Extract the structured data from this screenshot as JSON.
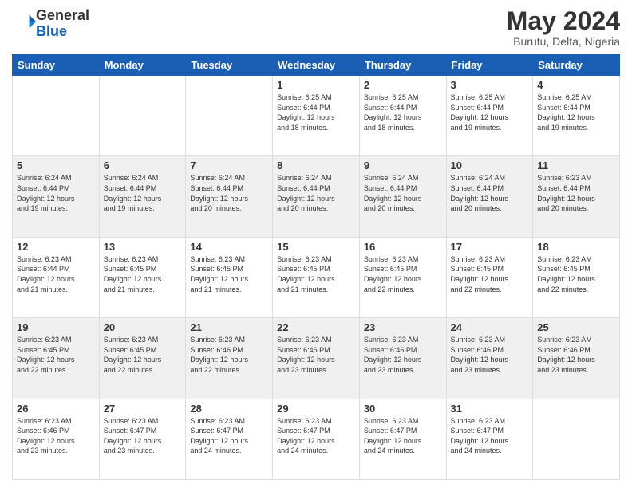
{
  "header": {
    "logo_text_general": "General",
    "logo_text_blue": "Blue",
    "month_year": "May 2024",
    "location": "Burutu, Delta, Nigeria"
  },
  "calendar": {
    "days_of_week": [
      "Sunday",
      "Monday",
      "Tuesday",
      "Wednesday",
      "Thursday",
      "Friday",
      "Saturday"
    ],
    "weeks": [
      [
        {
          "day": "",
          "info": ""
        },
        {
          "day": "",
          "info": ""
        },
        {
          "day": "",
          "info": ""
        },
        {
          "day": "1",
          "info": "Sunrise: 6:25 AM\nSunset: 6:44 PM\nDaylight: 12 hours\nand 18 minutes."
        },
        {
          "day": "2",
          "info": "Sunrise: 6:25 AM\nSunset: 6:44 PM\nDaylight: 12 hours\nand 18 minutes."
        },
        {
          "day": "3",
          "info": "Sunrise: 6:25 AM\nSunset: 6:44 PM\nDaylight: 12 hours\nand 19 minutes."
        },
        {
          "day": "4",
          "info": "Sunrise: 6:25 AM\nSunset: 6:44 PM\nDaylight: 12 hours\nand 19 minutes."
        }
      ],
      [
        {
          "day": "5",
          "info": "Sunrise: 6:24 AM\nSunset: 6:44 PM\nDaylight: 12 hours\nand 19 minutes."
        },
        {
          "day": "6",
          "info": "Sunrise: 6:24 AM\nSunset: 6:44 PM\nDaylight: 12 hours\nand 19 minutes."
        },
        {
          "day": "7",
          "info": "Sunrise: 6:24 AM\nSunset: 6:44 PM\nDaylight: 12 hours\nand 20 minutes."
        },
        {
          "day": "8",
          "info": "Sunrise: 6:24 AM\nSunset: 6:44 PM\nDaylight: 12 hours\nand 20 minutes."
        },
        {
          "day": "9",
          "info": "Sunrise: 6:24 AM\nSunset: 6:44 PM\nDaylight: 12 hours\nand 20 minutes."
        },
        {
          "day": "10",
          "info": "Sunrise: 6:24 AM\nSunset: 6:44 PM\nDaylight: 12 hours\nand 20 minutes."
        },
        {
          "day": "11",
          "info": "Sunrise: 6:23 AM\nSunset: 6:44 PM\nDaylight: 12 hours\nand 20 minutes."
        }
      ],
      [
        {
          "day": "12",
          "info": "Sunrise: 6:23 AM\nSunset: 6:44 PM\nDaylight: 12 hours\nand 21 minutes."
        },
        {
          "day": "13",
          "info": "Sunrise: 6:23 AM\nSunset: 6:45 PM\nDaylight: 12 hours\nand 21 minutes."
        },
        {
          "day": "14",
          "info": "Sunrise: 6:23 AM\nSunset: 6:45 PM\nDaylight: 12 hours\nand 21 minutes."
        },
        {
          "day": "15",
          "info": "Sunrise: 6:23 AM\nSunset: 6:45 PM\nDaylight: 12 hours\nand 21 minutes."
        },
        {
          "day": "16",
          "info": "Sunrise: 6:23 AM\nSunset: 6:45 PM\nDaylight: 12 hours\nand 22 minutes."
        },
        {
          "day": "17",
          "info": "Sunrise: 6:23 AM\nSunset: 6:45 PM\nDaylight: 12 hours\nand 22 minutes."
        },
        {
          "day": "18",
          "info": "Sunrise: 6:23 AM\nSunset: 6:45 PM\nDaylight: 12 hours\nand 22 minutes."
        }
      ],
      [
        {
          "day": "19",
          "info": "Sunrise: 6:23 AM\nSunset: 6:45 PM\nDaylight: 12 hours\nand 22 minutes."
        },
        {
          "day": "20",
          "info": "Sunrise: 6:23 AM\nSunset: 6:45 PM\nDaylight: 12 hours\nand 22 minutes."
        },
        {
          "day": "21",
          "info": "Sunrise: 6:23 AM\nSunset: 6:46 PM\nDaylight: 12 hours\nand 22 minutes."
        },
        {
          "day": "22",
          "info": "Sunrise: 6:23 AM\nSunset: 6:46 PM\nDaylight: 12 hours\nand 23 minutes."
        },
        {
          "day": "23",
          "info": "Sunrise: 6:23 AM\nSunset: 6:46 PM\nDaylight: 12 hours\nand 23 minutes."
        },
        {
          "day": "24",
          "info": "Sunrise: 6:23 AM\nSunset: 6:46 PM\nDaylight: 12 hours\nand 23 minutes."
        },
        {
          "day": "25",
          "info": "Sunrise: 6:23 AM\nSunset: 6:46 PM\nDaylight: 12 hours\nand 23 minutes."
        }
      ],
      [
        {
          "day": "26",
          "info": "Sunrise: 6:23 AM\nSunset: 6:46 PM\nDaylight: 12 hours\nand 23 minutes."
        },
        {
          "day": "27",
          "info": "Sunrise: 6:23 AM\nSunset: 6:47 PM\nDaylight: 12 hours\nand 23 minutes."
        },
        {
          "day": "28",
          "info": "Sunrise: 6:23 AM\nSunset: 6:47 PM\nDaylight: 12 hours\nand 24 minutes."
        },
        {
          "day": "29",
          "info": "Sunrise: 6:23 AM\nSunset: 6:47 PM\nDaylight: 12 hours\nand 24 minutes."
        },
        {
          "day": "30",
          "info": "Sunrise: 6:23 AM\nSunset: 6:47 PM\nDaylight: 12 hours\nand 24 minutes."
        },
        {
          "day": "31",
          "info": "Sunrise: 6:23 AM\nSunset: 6:47 PM\nDaylight: 12 hours\nand 24 minutes."
        },
        {
          "day": "",
          "info": ""
        }
      ]
    ]
  }
}
